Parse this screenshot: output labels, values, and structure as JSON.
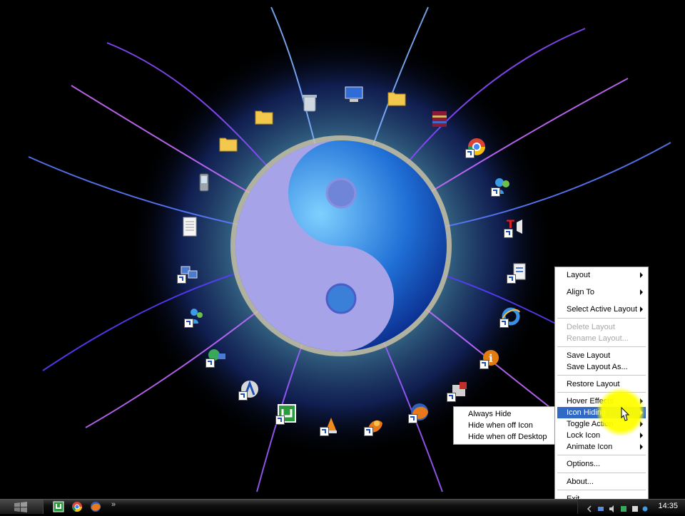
{
  "desktop": {
    "wallpaper": "yin-yang-fractal-wallpaper",
    "icons": [
      {
        "name": "recycle-bin-icon"
      },
      {
        "name": "my-computer-icon"
      },
      {
        "name": "folder-icon"
      },
      {
        "name": "winrar-archive-icon"
      },
      {
        "name": "chrome-shortcut-icon"
      },
      {
        "name": "messenger-shortcut-icon"
      },
      {
        "name": "media-player-shortcut-icon"
      },
      {
        "name": "document-shortcut-icon"
      },
      {
        "name": "internet-explorer-shortcut-icon"
      },
      {
        "name": "info-shortcut-icon"
      },
      {
        "name": "settings-shortcut-icon"
      },
      {
        "name": "firefox-shortcut-icon"
      },
      {
        "name": "firefox-alt-shortcut-icon"
      },
      {
        "name": "vlc-shortcut-icon"
      },
      {
        "name": "utorrent-shortcut-icon"
      },
      {
        "name": "avast-shortcut-icon"
      },
      {
        "name": "network-shortcut-icon"
      },
      {
        "name": "msn-shortcut-icon"
      },
      {
        "name": "network-places-shortcut-icon"
      },
      {
        "name": "text-document-icon"
      },
      {
        "name": "mobile-device-icon"
      },
      {
        "name": "folder-icon"
      },
      {
        "name": "folder-icon"
      }
    ]
  },
  "context_menu": {
    "items": [
      {
        "label": "Layout",
        "submenu": true
      },
      {
        "label": "Align To",
        "submenu": true
      },
      {
        "label": "Select Active Layout",
        "submenu": true
      },
      {
        "label": "Delete Layout",
        "disabled": true
      },
      {
        "label": "Rename Layout...",
        "disabled": true
      },
      {
        "label": "Save Layout"
      },
      {
        "label": "Save Layout As..."
      },
      {
        "label": "Restore Layout"
      },
      {
        "label": "Hover Effects",
        "submenu": true
      },
      {
        "label": "Icon Hiding",
        "submenu": true,
        "highlighted": true
      },
      {
        "label": "Toggle Action",
        "submenu": true
      },
      {
        "label": "Lock Icon",
        "submenu": true
      },
      {
        "label": "Animate Icon",
        "submenu": true
      },
      {
        "label": "Options..."
      },
      {
        "label": "About..."
      },
      {
        "label": "Exit"
      }
    ],
    "highlight_color": "#3169c6"
  },
  "submenu": {
    "items": [
      {
        "label": "Always Hide"
      },
      {
        "label": "Hide when off Icon"
      },
      {
        "label": "Hide when off Desktop"
      }
    ]
  },
  "taskbar": {
    "quick_launch": [
      {
        "name": "utorrent-icon"
      },
      {
        "name": "chrome-icon"
      },
      {
        "name": "firefox-icon"
      }
    ],
    "more_label": "»",
    "clock": "14:35"
  },
  "cursor": {
    "highlight_color": "#ffff00"
  }
}
